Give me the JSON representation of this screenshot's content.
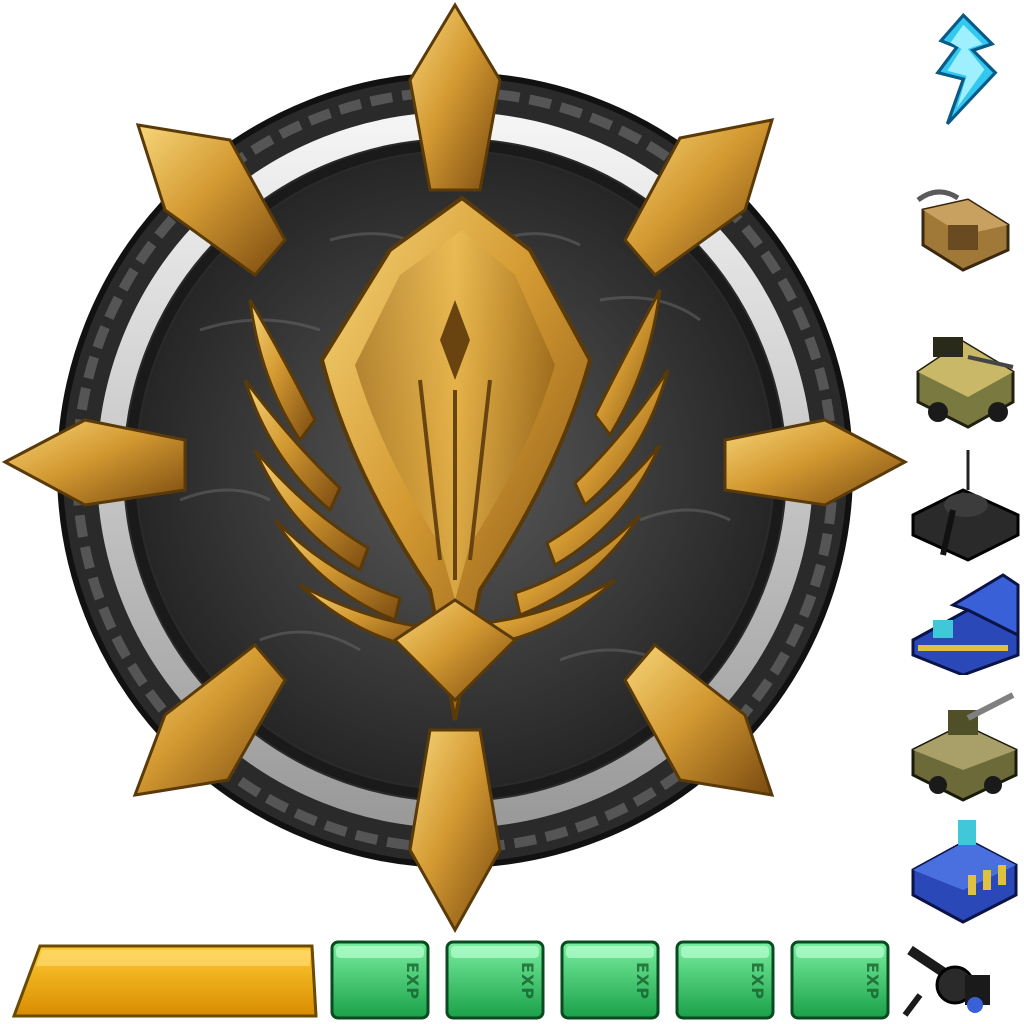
{
  "emblem": {
    "name": "rank-emblem",
    "colors": {
      "gold_light": "#f2c45a",
      "gold_mid": "#d49a32",
      "gold_dark": "#8a5a14",
      "ring_dark": "#2a2a2a",
      "ring_silver": "#d8d8d8",
      "field": "#3c3c3c"
    }
  },
  "sidebar": {
    "items": [
      {
        "icon": "lightning-bolt-icon",
        "color": "#33c8f0"
      },
      {
        "icon": "harvester-vehicle-icon",
        "color": "#a07838"
      },
      {
        "icon": "armored-truck-icon",
        "color": "#7a7a40"
      },
      {
        "icon": "dark-tank-icon",
        "color": "#2a2a2a"
      },
      {
        "icon": "blue-factory-icon",
        "color": "#3050c0"
      },
      {
        "icon": "artillery-vehicle-icon",
        "color": "#6c6a38"
      },
      {
        "icon": "blue-tech-building-icon",
        "color": "#2a48b8"
      }
    ]
  },
  "bottom_bar": {
    "gold_bar_color": "#e8a800",
    "exp_tiles": [
      {
        "label": "EXP"
      },
      {
        "label": "EXP"
      },
      {
        "label": "EXP"
      },
      {
        "label": "EXP"
      },
      {
        "label": "EXP"
      }
    ],
    "exp_color": "#2ecf66",
    "corner_icon": "turret-gun-icon"
  }
}
